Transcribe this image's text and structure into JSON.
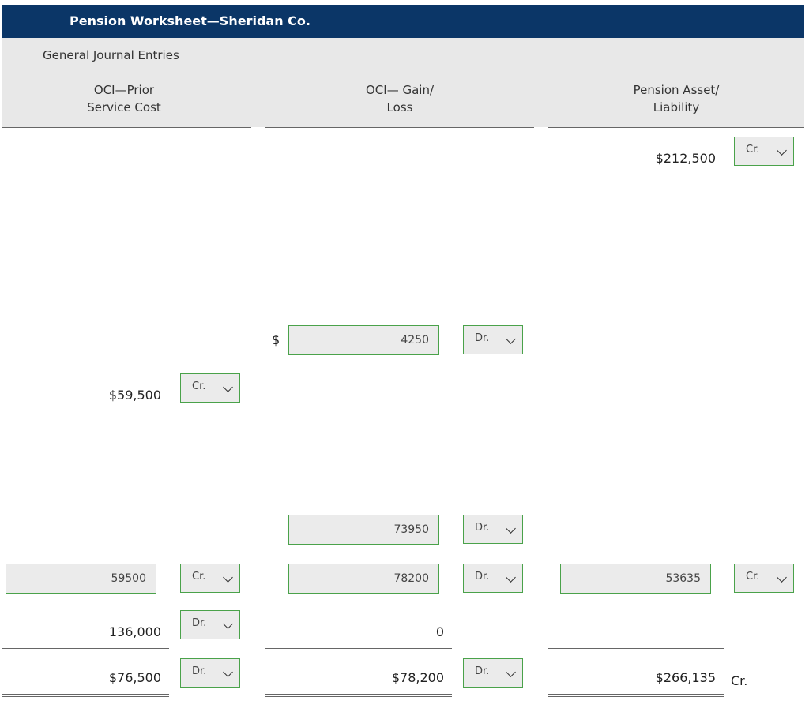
{
  "header": {
    "title": "Pension Worksheet—Sheridan Co."
  },
  "subheader": {
    "label": "General Journal Entries"
  },
  "columns": {
    "oci_psc": {
      "line1": "OCI—Prior",
      "line2": "Service Cost"
    },
    "oci_gl": {
      "line1": "OCI— Gain/",
      "line2": "Loss"
    },
    "pension": {
      "line1": "Pension Asset/",
      "line2": "Liability"
    }
  },
  "rows": {
    "pension_beginning": {
      "value": "$212,500",
      "select": "Cr."
    },
    "gain_loss_entry": {
      "currency": "$",
      "input": "4250",
      "select": "Dr."
    },
    "psc_entry": {
      "value": "$59,500",
      "select": "Cr."
    },
    "gain_loss_entry2": {
      "input": "73950",
      "select": "Dr."
    },
    "journal_entry": {
      "psc_input": "59500",
      "psc_select": "Cr.",
      "gl_input": "78200",
      "gl_select": "Dr.",
      "pension_input": "53635",
      "pension_select": "Cr."
    },
    "balance_prior": {
      "psc_value": "136,000",
      "psc_select": "Dr.",
      "gl_value": "0"
    },
    "ending": {
      "psc_value": "$76,500",
      "psc_select": "Dr.",
      "gl_value": "$78,200",
      "gl_select": "Dr.",
      "pension_value": "$266,135",
      "pension_suffix": "Cr."
    }
  }
}
